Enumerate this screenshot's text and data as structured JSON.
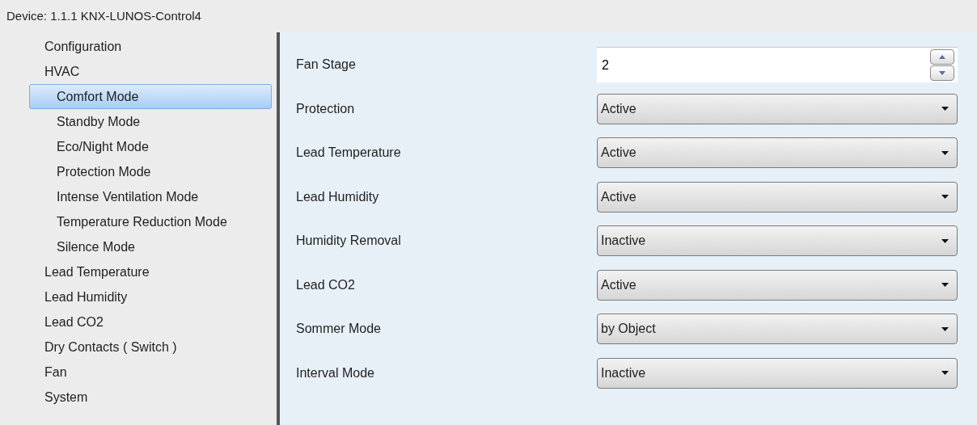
{
  "header": {
    "title": "Device: 1.1.1  KNX-LUNOS-Control4"
  },
  "sidebar": {
    "items": [
      {
        "label": "Configuration",
        "selected": false
      },
      {
        "label": "HVAC",
        "selected": false,
        "children": [
          {
            "label": "Comfort Mode",
            "selected": true
          },
          {
            "label": "Standby Mode",
            "selected": false
          },
          {
            "label": "Eco/Night Mode",
            "selected": false
          },
          {
            "label": "Protection Mode",
            "selected": false
          },
          {
            "label": "Intense Ventilation Mode",
            "selected": false
          },
          {
            "label": "Temperature Reduction Mode",
            "selected": false
          },
          {
            "label": "Silence Mode",
            "selected": false
          }
        ]
      },
      {
        "label": "Lead Temperature",
        "selected": false
      },
      {
        "label": "Lead Humidity",
        "selected": false
      },
      {
        "label": "Lead CO2",
        "selected": false
      },
      {
        "label": "Dry Contacts ( Switch )",
        "selected": false
      },
      {
        "label": "Fan",
        "selected": false
      },
      {
        "label": "System",
        "selected": false
      }
    ]
  },
  "parameters": [
    {
      "kind": "spinner",
      "label": "Fan Stage",
      "value": "2"
    },
    {
      "kind": "dropdown",
      "label": "Protection",
      "value": "Active"
    },
    {
      "kind": "dropdown",
      "label": "Lead Temperature",
      "value": "Active"
    },
    {
      "kind": "dropdown",
      "label": "Lead Humidity",
      "value": "Active"
    },
    {
      "kind": "dropdown",
      "label": "Humidity Removal",
      "value": "Inactive"
    },
    {
      "kind": "dropdown",
      "label": "Lead CO2",
      "value": "Active"
    },
    {
      "kind": "dropdown",
      "label": "Sommer Mode",
      "value": "by Object"
    },
    {
      "kind": "dropdown",
      "label": "Interval Mode",
      "value": "Inactive"
    }
  ]
}
